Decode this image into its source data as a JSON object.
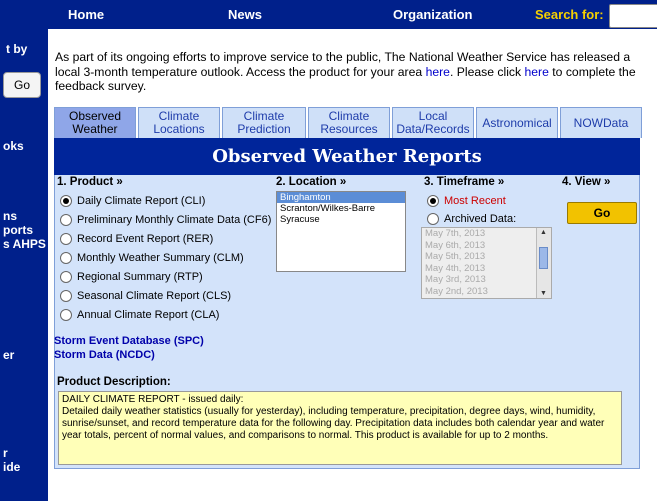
{
  "topnav": {
    "home": "Home",
    "news": "News",
    "organization": "Organization",
    "search_label": "Search for:"
  },
  "sidebar": {
    "t1": "t by",
    "go": "Go",
    "t2": "oks",
    "t3": "ns",
    "t4": "ports",
    "t5": "s AHPS",
    "t6": "er",
    "t7": "r",
    "t8": "ide"
  },
  "intro": {
    "text1": "As part of its ongoing efforts to improve service to the public, The National Weather Service has released a local 3-month temperature outlook. Access the product for your area ",
    "link1": "here",
    "text2": ". Please click ",
    "link2": "here",
    "text3": " to complete the feedback survey."
  },
  "tabs": [
    {
      "l1": "Observed",
      "l2": "Weather"
    },
    {
      "l1": "Climate",
      "l2": "Locations"
    },
    {
      "l1": "Climate",
      "l2": "Prediction"
    },
    {
      "l1": "Climate",
      "l2": "Resources"
    },
    {
      "l1": "Local",
      "l2": "Data/Records"
    },
    {
      "l1": "Astronomical",
      "l2": ""
    },
    {
      "l1": "NOWData",
      "l2": ""
    }
  ],
  "panel_title": "Observed Weather Reports",
  "sections": {
    "product": "1. Product »",
    "location": "2. Location »",
    "timeframe": "3. Timeframe »",
    "view": "4. View »"
  },
  "products": [
    "Daily Climate Report (CLI)",
    "Preliminary Monthly Climate Data (CF6)",
    "Record Event Report (RER)",
    "Monthly Weather Summary (CLM)",
    "Regional Summary (RTP)",
    "Seasonal Climate Report (CLS)",
    "Annual Climate Report (CLA)"
  ],
  "locations": [
    "Binghamton",
    "Scranton/Wilkes-Barre",
    "Syracuse"
  ],
  "timeframe": {
    "recent": "Most Recent",
    "archived": "Archived Data:"
  },
  "dates": [
    "May 7th, 2013",
    "May 6th, 2013",
    "May 5th, 2013",
    "May 4th, 2013",
    "May 3rd, 2013",
    "May 2nd, 2013"
  ],
  "go": "Go",
  "links": {
    "storm_event": "Storm Event Database (SPC)",
    "storm_data": "Storm Data (NCDC)"
  },
  "description": {
    "label": "Product Description:",
    "line1": "DAILY CLIMATE REPORT - issued daily:",
    "line2": "Detailed daily weather statistics (usually for yesterday), including temperature, precipitation, degree days, wind, humidity, sunrise/sunset, and record temperature data for the following day.  Precipitation data includes both calendar year and water year totals, percent of normal values, and comparisons to normal.  This product is available for up to 2 months."
  }
}
